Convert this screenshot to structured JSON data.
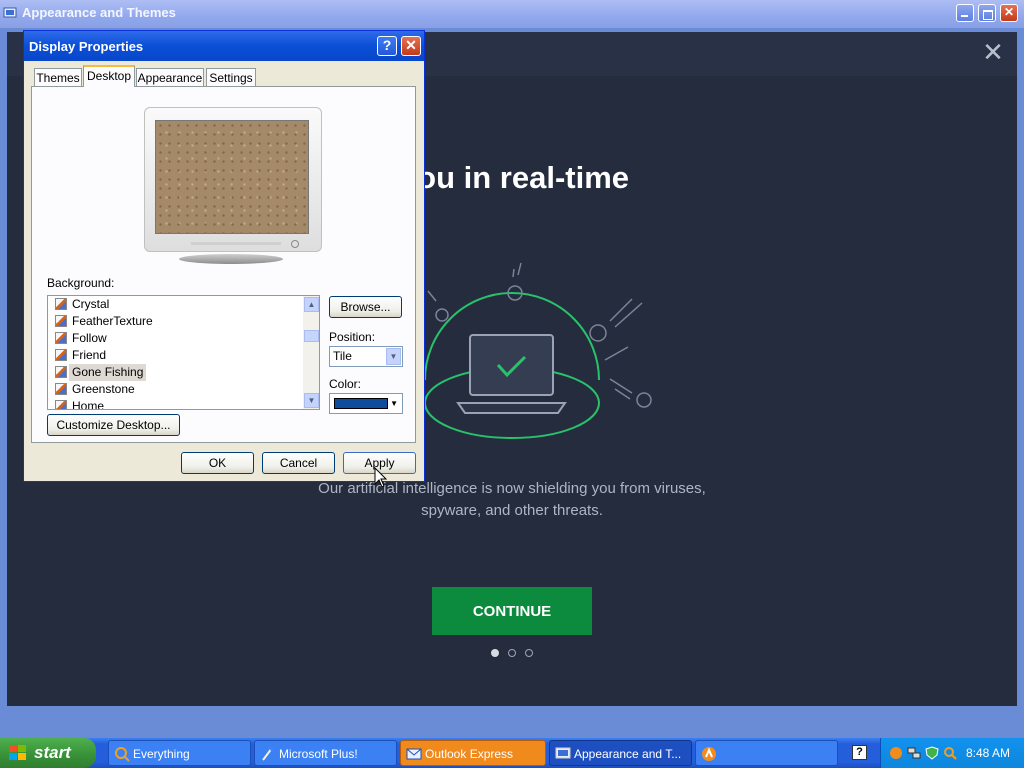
{
  "outer_window": {
    "title": "Appearance and Themes"
  },
  "promo": {
    "headline": "ecting you in real-time",
    "description_line1": "Our artificial intelligence is now shielding you from viruses,",
    "description_line2": "spyware, and other threats.",
    "continue_label": "CONTINUE",
    "page_dots": {
      "count": 3,
      "active_index": 0
    },
    "accent_color": "#0c8a3e",
    "close_glyph": "✕"
  },
  "dialog": {
    "title": "Display Properties",
    "help_glyph": "?",
    "close_glyph": "✕",
    "tabs": [
      {
        "label": "Themes",
        "active": false
      },
      {
        "label": "Desktop",
        "active": true
      },
      {
        "label": "Appearance",
        "active": false
      },
      {
        "label": "Settings",
        "active": false
      }
    ],
    "background_label": "Background:",
    "backgrounds": [
      {
        "label": "Crystal",
        "selected": false
      },
      {
        "label": "FeatherTexture",
        "selected": false
      },
      {
        "label": "Follow",
        "selected": false
      },
      {
        "label": "Friend",
        "selected": false
      },
      {
        "label": "Gone Fishing",
        "selected": true
      },
      {
        "label": "Greenstone",
        "selected": false
      },
      {
        "label": "Home",
        "selected": false
      }
    ],
    "browse_label": "Browse...",
    "position_label": "Position:",
    "position_value": "Tile",
    "color_label": "Color:",
    "color_value": "#0d4d9c",
    "customize_label": "Customize Desktop...",
    "ok_label": "OK",
    "cancel_label": "Cancel",
    "apply_label": "Apply"
  },
  "taskbar": {
    "start_label": "start",
    "tasks": [
      {
        "label": "Everything",
        "icon": "search-icon"
      },
      {
        "label": "Microsoft Plus!",
        "icon": "plus-icon"
      },
      {
        "label": "Outlook Express",
        "icon": "outlook-icon"
      },
      {
        "label": "Appearance and T...",
        "icon": "display-icon"
      },
      {
        "label": "",
        "icon": "avast-icon"
      }
    ],
    "clock": "8:48 AM"
  }
}
